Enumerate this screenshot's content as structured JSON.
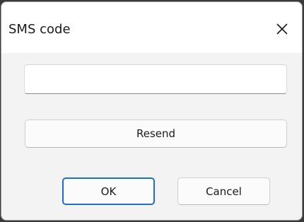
{
  "dialog": {
    "title": "SMS code",
    "close_icon": "close-icon"
  },
  "code_input": {
    "value": "",
    "placeholder": ""
  },
  "buttons": {
    "resend_label": "Resend",
    "ok_label": "OK",
    "cancel_label": "Cancel"
  },
  "colors": {
    "dialog_bg": "#f3f3f3",
    "titlebar_bg": "#ffffff",
    "accent_focus": "#1f6fc9"
  }
}
